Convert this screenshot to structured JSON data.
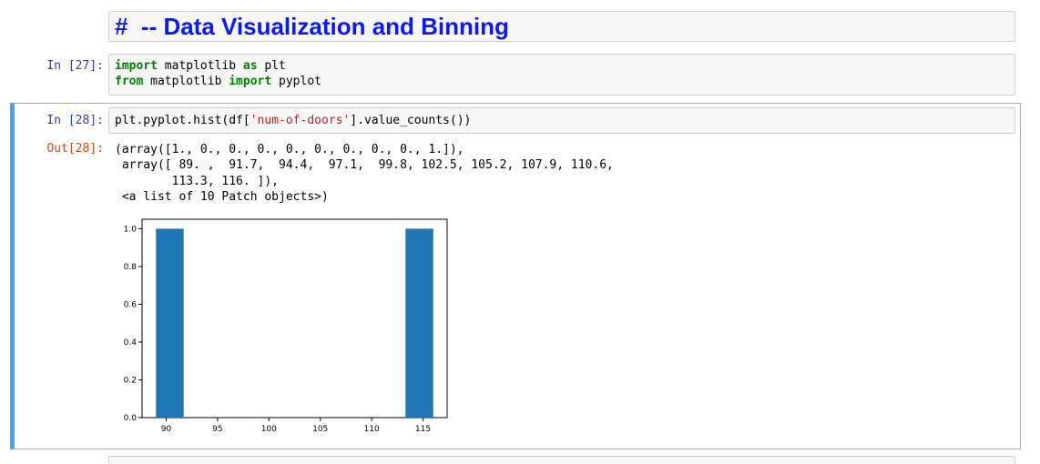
{
  "markdown": {
    "heading": "#  -- Data Visualization and Binning"
  },
  "cells": [
    {
      "prompt": "In [27]:",
      "lines": [
        [
          {
            "t": "import",
            "c": "kw"
          },
          {
            "t": " matplotlib "
          },
          {
            "t": "as",
            "c": "kw"
          },
          {
            "t": " plt"
          }
        ],
        [
          {
            "t": "from",
            "c": "kw"
          },
          {
            "t": " matplotlib "
          },
          {
            "t": "import",
            "c": "kw"
          },
          {
            "t": " pyplot"
          }
        ]
      ]
    },
    {
      "prompt": "In [28]:",
      "lines": [
        [
          {
            "t": "plt.pyplot.hist(df["
          },
          {
            "t": "'num-of-doors'",
            "c": "str"
          },
          {
            "t": "].value_counts())"
          }
        ]
      ]
    }
  ],
  "output": {
    "prompt": "Out[28]:",
    "text": "(array([1., 0., 0., 0., 0., 0., 0., 0., 0., 1.]),\n array([ 89. ,  91.7,  94.4,  97.1,  99.8, 102.5, 105.2, 107.9, 110.6,\n        113.3, 116. ]),\n <a list of 10 Patch objects>)"
  },
  "chart_data": {
    "type": "bar",
    "title": "",
    "xlabel": "",
    "ylabel": "",
    "bin_edges": [
      89.0,
      91.7,
      94.4,
      97.1,
      99.8,
      102.5,
      105.2,
      107.9,
      110.6,
      113.3,
      116.0
    ],
    "values": [
      1,
      0,
      0,
      0,
      0,
      0,
      0,
      0,
      0,
      1
    ],
    "xlim": [
      87.65,
      117.35
    ],
    "ylim": [
      0,
      1.05
    ],
    "xticks": [
      90,
      95,
      100,
      105,
      110,
      115
    ],
    "xtick_labels": [
      "90",
      "95",
      "100",
      "105",
      "110",
      "115"
    ],
    "yticks": [
      0.0,
      0.2,
      0.4,
      0.6,
      0.8,
      1.0
    ],
    "ytick_labels": [
      "0.0",
      "0.2",
      "0.4",
      "0.6",
      "0.8",
      "1.0"
    ],
    "bar_color": "#1f77b4",
    "grid": false
  }
}
